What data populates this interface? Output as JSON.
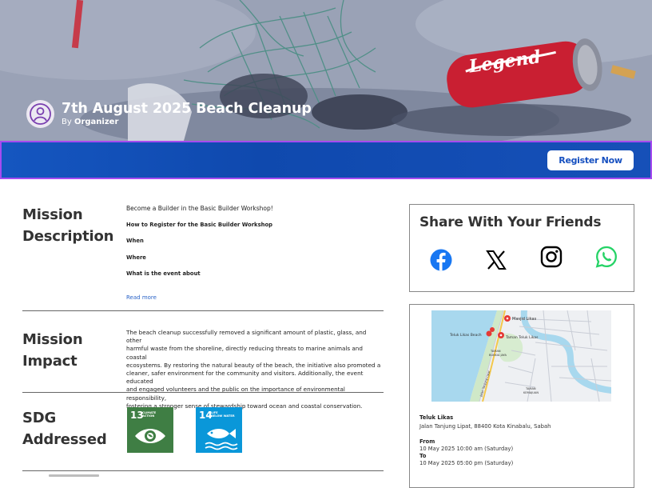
{
  "event": {
    "title": "7th August 2025 Beach Cleanup",
    "by_prefix": "By",
    "organizer": "Organizer",
    "can_label": "Legend"
  },
  "register": {
    "label": "Register Now"
  },
  "mission_description": {
    "heading_line1": "Mission",
    "heading_line2": "Description",
    "intro": "Become a Builder in the Basic Builder Workshop!",
    "how_to": "How to Register for the Basic Builder Workshop",
    "when": "When",
    "where": "Where",
    "what": "What is the event about",
    "read_more": "Read more"
  },
  "mission_impact": {
    "heading_line1": "Mission",
    "heading_line2": "Impact",
    "lines": [
      "The beach cleanup successfully removed a significant amount of plastic, glass, and other",
      "harmful waste from the shoreline, directly reducing threats to marine animals and coastal",
      "ecosystems. By restoring the natural beauty of the beach, the initiative also promoted a",
      "cleaner, safer environment for the community and visitors. Additionally, the event educated",
      "and engaged volunteers and the public on the importance of environmental responsibility,",
      "fostering a stronger sense of stewardship toward ocean and coastal conservation."
    ]
  },
  "sdg": {
    "heading_line1": "SDG",
    "heading_line2": "Addressed",
    "goals": [
      {
        "number": "13",
        "label_line1": "CLIMATE",
        "label_line2": "ACTION",
        "color": "#3f7e44",
        "icon": "eye-globe-icon"
      },
      {
        "number": "14",
        "label_line1": "LIFE",
        "label_line2": "BELOW WATER",
        "color": "#0a97d9",
        "icon": "fish-icon"
      }
    ]
  },
  "share": {
    "title": "Share With Your Friends",
    "icons": [
      {
        "name": "facebook-icon",
        "color": "#1877f2"
      },
      {
        "name": "x-icon",
        "color": "#000000"
      },
      {
        "name": "instagram-icon",
        "color": "#000000"
      },
      {
        "name": "whatsapp-icon",
        "color": "#25d366"
      }
    ]
  },
  "location": {
    "map_labels": {
      "masjid": "Masjid Likas",
      "beach": "Teluk Likas Beach",
      "taman": "Taman Teluk Likas",
      "taman2_line1": "TAMAN",
      "taman2_line2": "BUKKIA JAYA",
      "road": "Jalan Tanjung Lipat",
      "taman3_line1": "TAMAN",
      "taman3_line2": "KEMAJUAN"
    },
    "name": "Teluk Likas",
    "address": "Jalan Tanjung Lipat, 88400 Kota Kinabalu, Sabah",
    "from_label": "From",
    "from_value": "10 May 2025 10:00 am (Saturday)",
    "to_label": "To",
    "to_value": "10 May 2025 05:00 pm (Saturday)"
  },
  "colors": {
    "band": "#1050b8",
    "band_border": "#a54bf0",
    "link": "#2a63c7"
  }
}
